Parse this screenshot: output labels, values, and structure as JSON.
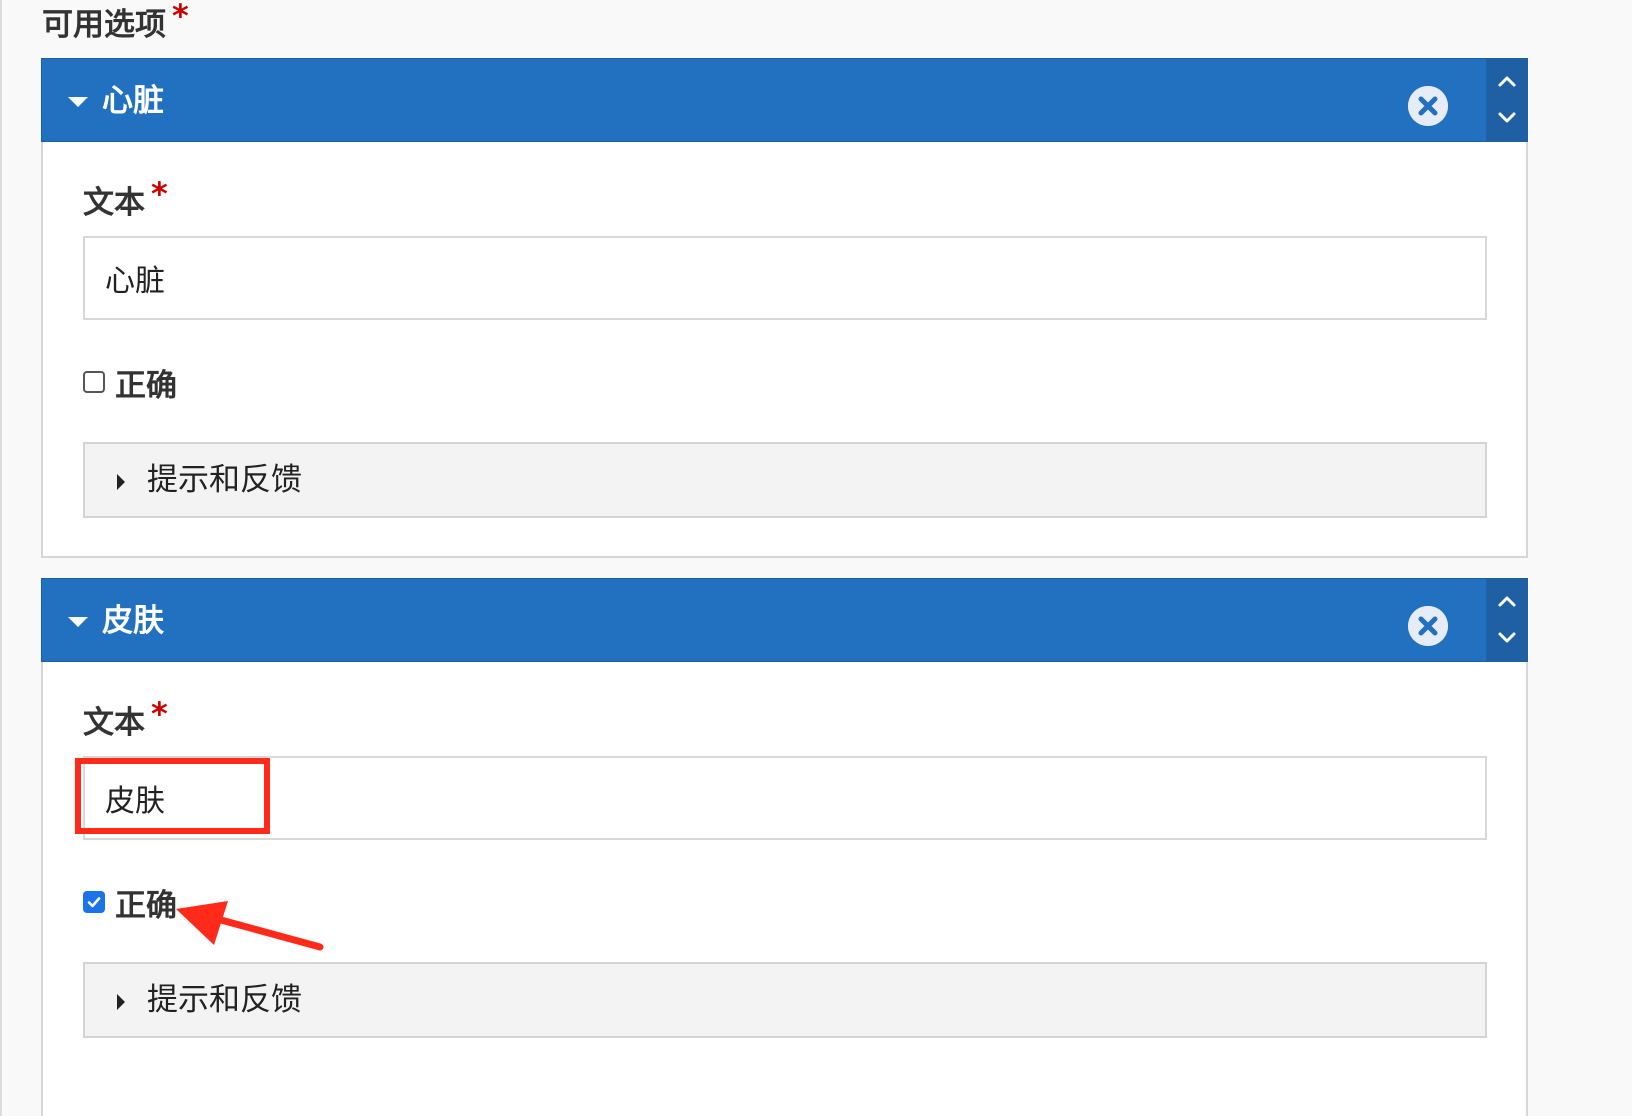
{
  "section": {
    "label": "可用选项",
    "required_mark": "*"
  },
  "options": [
    {
      "title": "心脏",
      "text_label": "文本",
      "required_mark": "*",
      "text_value": "心脏",
      "correct_label": "正确",
      "correct_checked": false,
      "feedback_label": "提示和反馈"
    },
    {
      "title": "皮肤",
      "text_label": "文本",
      "required_mark": "*",
      "text_value": "皮肤",
      "correct_label": "正确",
      "correct_checked": true,
      "feedback_label": "提示和反馈"
    }
  ],
  "icons": {
    "collapse": "caret-down-icon",
    "remove": "circle-x-icon",
    "move_up": "chevron-up-icon",
    "move_down": "chevron-down-icon",
    "expand": "caret-right-icon"
  },
  "colors": {
    "header_blue": "#2270c0",
    "mover_blue": "#1f5fa3",
    "required_red": "#cc0000",
    "annotation_red": "#ff2a1a",
    "checkbox_blue": "#1a73e8"
  }
}
